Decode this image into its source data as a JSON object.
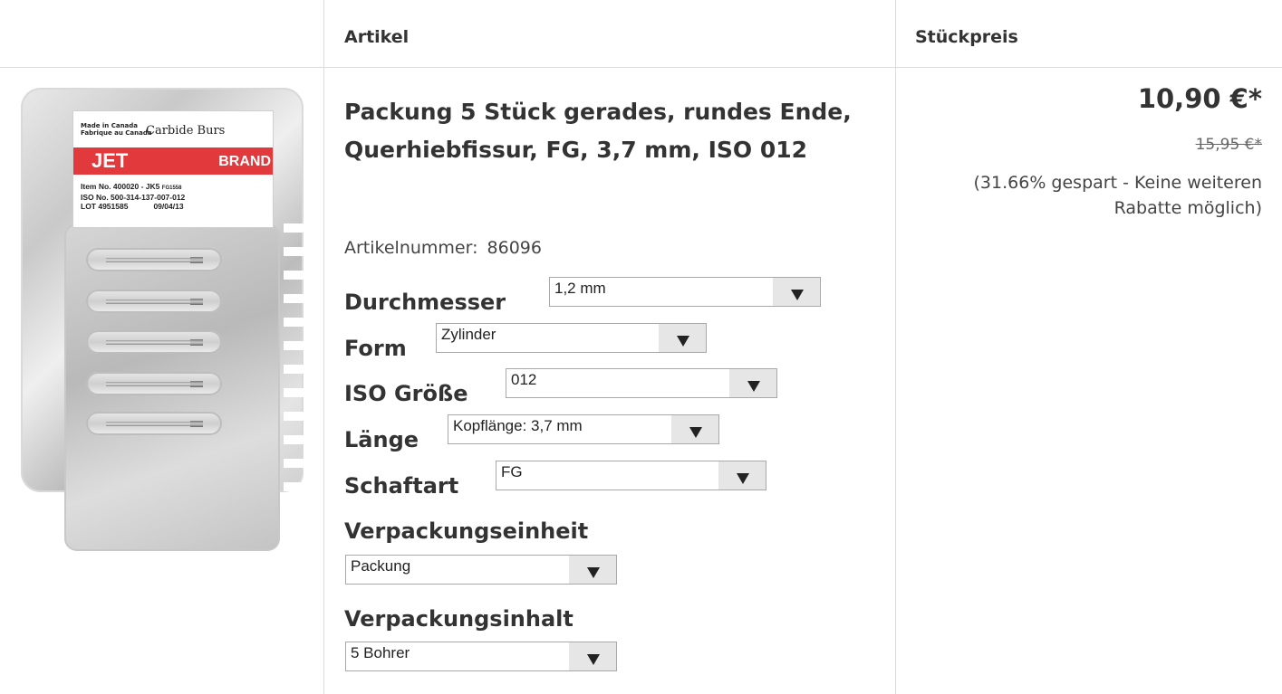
{
  "table": {
    "headers": {
      "article": "Artikel",
      "unit_price": "Stückpreis"
    }
  },
  "product": {
    "image": {
      "icon": "product-blister-pack-image",
      "label_made_in": "Made in Canada",
      "label_fabrique": "Fabrique au Canada",
      "label_title": "Carbide Burs",
      "label_jet": "JET",
      "label_brand": "BRAND",
      "label_item": "Item No. 400020 - JK5",
      "label_fg": "FG1558",
      "label_iso": "ISO No. 500-314-137-007-012",
      "label_lot": "LOT 4951585",
      "label_date": "09/04/13",
      "accent_color": "#e23a3c"
    },
    "title": "Packung 5 Stück gerades, rundes Ende, Querhiebfissur, FG, 3,7 mm, ISO 012",
    "article_number_label": "Artikelnummer:",
    "article_number": "86096",
    "options": {
      "durchmesser": {
        "label": "Durchmesser",
        "value": "1,2 mm"
      },
      "form": {
        "label": "Form",
        "value": "Zylinder"
      },
      "iso": {
        "label": "ISO Größe",
        "value": "012"
      },
      "laenge": {
        "label": "Länge",
        "value": "Kopflänge: 3,7 mm"
      },
      "schaftart": {
        "label": "Schaftart",
        "value": "FG"
      },
      "verpackungseinheit": {
        "label": "Verpackungseinheit",
        "value": "Packung"
      },
      "verpackungsinhalt": {
        "label": "Verpackungsinhalt",
        "value": "5 Bohrer"
      }
    }
  },
  "price": {
    "current": "10,90 €*",
    "old": "15,95 €*",
    "saving": "(31.66% gespart - Keine weiteren Rabatte möglich)"
  }
}
